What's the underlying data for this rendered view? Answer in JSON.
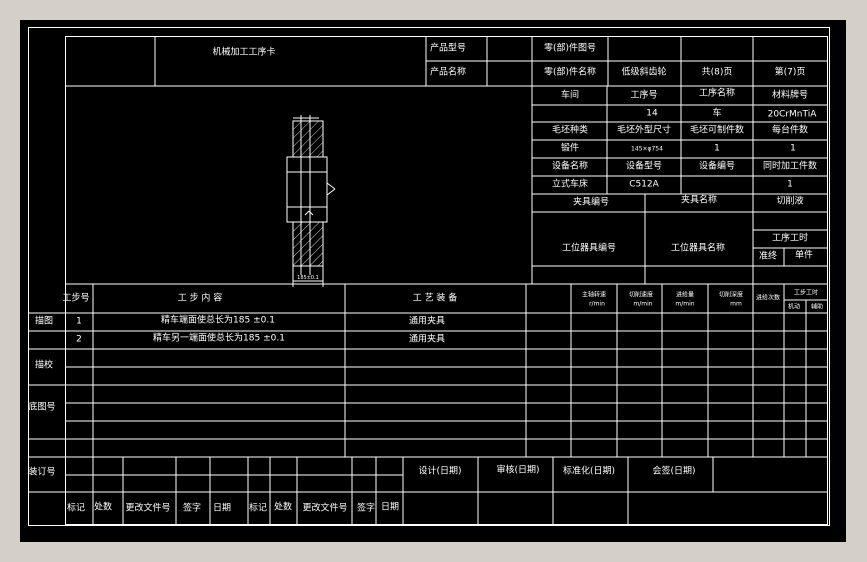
{
  "header": {
    "card_title": "机械加工工序卡",
    "product_model_label": "产品型号",
    "product_name_label": "产品名称",
    "part_no_label": "零(部)件图号",
    "part_name_label": "零(部)件名称",
    "part_name_value": "低级斜齿轮",
    "total_pages": "共(8)页",
    "page_no": "第(7)页"
  },
  "info": {
    "workshop_label": "车间",
    "op_no_label": "工序号",
    "op_name_label": "工序名称",
    "material_label": "材料牌号",
    "op_no_value": "14",
    "op_name_value": "车",
    "material_value": "20CrMnTiA",
    "blank_type_label": "毛坯种类",
    "blank_size_label": "毛坯外型尺寸",
    "blank_qty_label": "毛坯可制件数",
    "per_unit_label": "每台件数",
    "blank_type_value": "锻件",
    "blank_size_value": "145×φ754",
    "blank_qty_value": "1",
    "per_unit_value": "1",
    "equip_name_label": "设备名称",
    "equip_model_label": "设备型号",
    "equip_no_label": "设备编号",
    "concurrent_label": "同时加工件数",
    "equip_name_value": "立式车床",
    "equip_model_value": "C512A",
    "concurrent_value": "1",
    "fixture_no_label": "夹具编号",
    "fixture_name_label": "夹具名称",
    "coolant_label": "切削液",
    "station_tool_no_label": "工位器具编号",
    "station_tool_name_label": "工位器具名称",
    "op_time_label": "工序工时",
    "prep_time_label": "准终",
    "unit_time_label": "单件"
  },
  "steps_table": {
    "step_no_label": "工步号",
    "step_content_label": "工 步 内 容",
    "equipment_label": "工 艺 装 备",
    "spindle_speed_label": "主轴转速",
    "spindle_speed_unit": "r/min",
    "cutting_speed_label": "切削速度",
    "cutting_speed_unit": "m/min",
    "feed_label": "进给量",
    "feed_unit": "m/min",
    "depth_label": "切削深度",
    "depth_unit": "mm",
    "passes_label": "进给次数",
    "step_time_label": "工步工时",
    "machine_time_label": "机动",
    "aux_time_label": "辅助",
    "rows": [
      {
        "no": "1",
        "content": "精车端面使总长为185 ±0.1",
        "equipment": "通用夹具"
      },
      {
        "no": "2",
        "content": "精车另一端面使总长为185 ±0.1",
        "equipment": "通用夹具"
      }
    ]
  },
  "side": {
    "drawing_label": "描图",
    "check_label": "描校",
    "base_no_label": "底图号",
    "binding_label": "装订号"
  },
  "footer": {
    "design_label": "设计(日期)",
    "review_label": "审核(日期)",
    "standard_label": "标准化(日期)",
    "countersign_label": "会签(日期)",
    "mark1": "标记",
    "count1": "处数",
    "change1": "更改文件号",
    "sign1": "签字",
    "date1": "日期",
    "mark2": "标记",
    "count2": "处数",
    "change2": "更改文件号",
    "sign2": "签字",
    "date2": "日期"
  },
  "drawing": {
    "dim_text": "185±0.1"
  },
  "colors": {
    "background": "#000000",
    "lines": "#ffffff",
    "window": "#d4d0c8"
  }
}
